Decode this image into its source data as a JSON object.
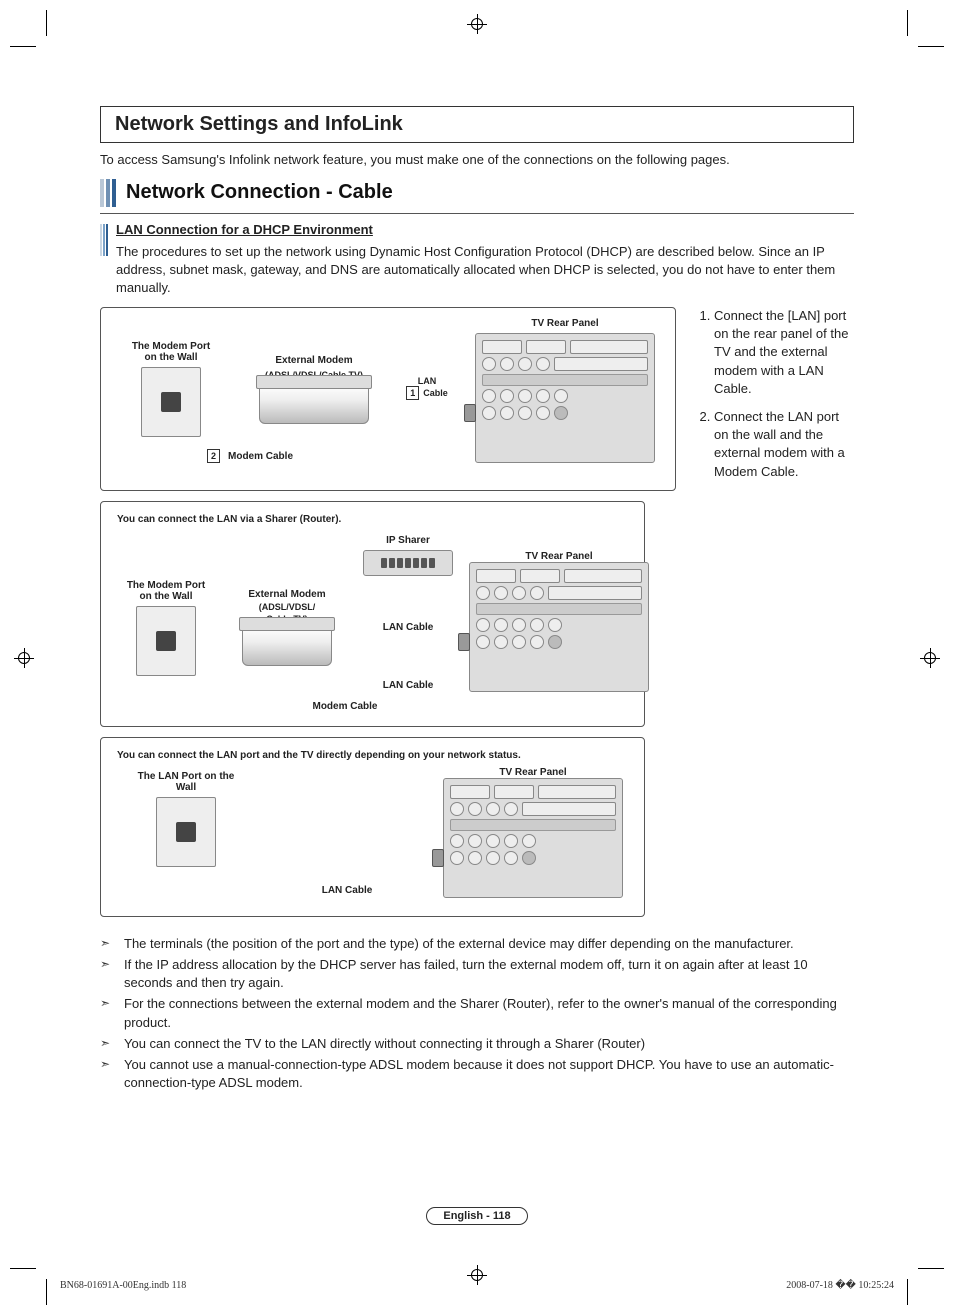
{
  "header": {
    "title": "Network Settings and InfoLink"
  },
  "intro": "To access Samsung's Infolink network feature, you must make one of the connections on the following pages.",
  "section2": {
    "title": "Network Connection - Cable"
  },
  "sub": {
    "title": "LAN Connection for a DHCP Environment",
    "desc": "The procedures to set up the network using Dynamic Host Configuration Protocol (DHCP) are described below. Since an IP address, subnet mask, gateway, and DNS are automatically allocated when DHCP is selected, you do not have to enter them manually."
  },
  "steps": {
    "s1": "Connect the [LAN] port on the rear panel of the TV and the external modem with a LAN Cable.",
    "s2": "Connect the LAN port on the wall and the external modem with a Modem Cable."
  },
  "diagram1": {
    "tv_rear": "TV Rear Panel",
    "wall_label": "The Modem Port on the Wall",
    "ext_modem_line1": "External Modem",
    "ext_modem_line2": "(ADSL/VDSL/Cable TV)",
    "lan_cable": "LAN Cable",
    "modem_cable": "Modem Cable",
    "tag1": "1",
    "tag2": "2"
  },
  "diagram2": {
    "heading": "You can connect the LAN via a Sharer (Router).",
    "ip_sharer": "IP Sharer",
    "tv_rear": "TV Rear Panel",
    "wall_label": "The Modem Port on the Wall",
    "ext_modem_line1": "External Modem",
    "ext_modem_line2": "(ADSL/VDSL/",
    "ext_modem_line3": "Cable TV)",
    "lan_cable": "LAN Cable",
    "modem_cable": "Modem Cable"
  },
  "diagram3": {
    "heading": "You can connect the LAN port and the TV directly depending on your network status.",
    "tv_rear": "TV Rear Panel",
    "wall_label": "The LAN Port on the Wall",
    "lan_cable": "LAN Cable"
  },
  "notes": {
    "n1": "The terminals (the position of the port and the type) of the external device may differ depending on the manufacturer.",
    "n2": "If the IP address allocation by the DHCP server has failed, turn the external modem off, turn it on again after at least 10 seconds and then try again.",
    "n3": "For the connections between the external modem and the Sharer (Router), refer to the owner's manual of the corresponding product.",
    "n4": "You can connect the TV to the LAN directly without connecting it through a Sharer (Router)",
    "n5": "You cannot use a manual-connection-type ADSL modem because it does not support DHCP. You have to use an automatic-connection-type ADSL modem."
  },
  "footer": {
    "page_label": "English - 118",
    "left": "BN68-01691A-00Eng.indb   118",
    "right": "2008-07-18   �� 10:25:24"
  }
}
